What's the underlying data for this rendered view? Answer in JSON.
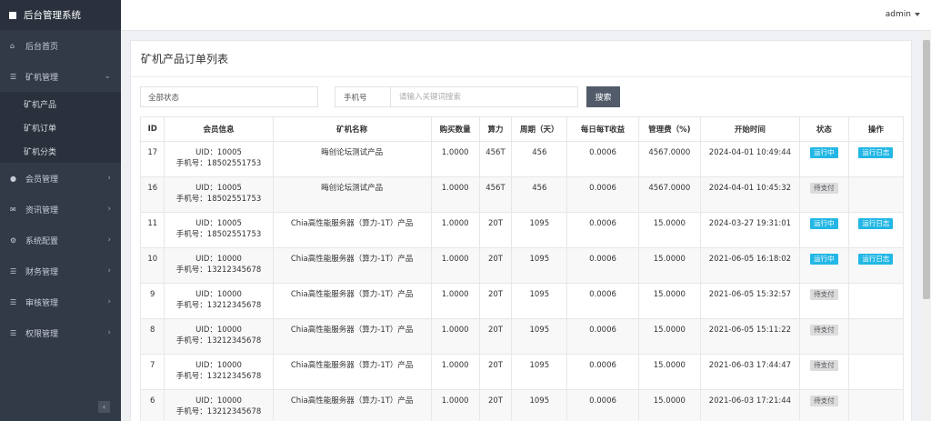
{
  "sidebar": {
    "brand": "后台管理系统",
    "home": "后台首页",
    "miner_mgmt": "矿机管理",
    "miner_sub": [
      "矿机产品",
      "矿机订单",
      "矿机分类"
    ],
    "member_mgmt": "会员管理",
    "news_mgmt": "资讯管理",
    "system_config": "系统配置",
    "finance_mgmt": "财务管理",
    "audit_mgmt": "审核管理",
    "permission_mgmt": "权限管理",
    "collapse": "‹"
  },
  "topbar": {
    "user": "admin"
  },
  "page": {
    "title": "矿机产品订单列表"
  },
  "filters": {
    "status_selected": "全部状态",
    "field_selected": "手机号",
    "keyword_placeholder": "请输入关键词搜索",
    "search_label": "搜索"
  },
  "table": {
    "headers": [
      "ID",
      "会员信息",
      "矿机名称",
      "购买数量",
      "算力",
      "周期（天）",
      "每日每T收益",
      "管理费（%)",
      "开始时间",
      "状态",
      "操作"
    ],
    "rows": [
      {
        "id": "17",
        "uid": "UID：10005",
        "phone": "手机号：18502551753",
        "name": "晦创论坛测试产品",
        "qty": "1.0000",
        "power": "456T",
        "cycle": "456",
        "daily": "0.0006",
        "fee": "4567.0000",
        "start": "2024-04-01 10:49:44",
        "status": "运行中",
        "action": "运行日志"
      },
      {
        "id": "16",
        "uid": "UID：10005",
        "phone": "手机号：18502551753",
        "name": "晦创论坛测试产品",
        "qty": "1.0000",
        "power": "456T",
        "cycle": "456",
        "daily": "0.0006",
        "fee": "4567.0000",
        "start": "2024-04-01 10:45:32",
        "status": "待支付",
        "action": ""
      },
      {
        "id": "11",
        "uid": "UID：10005",
        "phone": "手机号：18502551753",
        "name": "Chia高性能服务器（算力-1T）产品",
        "qty": "1.0000",
        "power": "20T",
        "cycle": "1095",
        "daily": "0.0006",
        "fee": "15.0000",
        "start": "2024-03-27 19:31:01",
        "status": "运行中",
        "action": "运行日志"
      },
      {
        "id": "10",
        "uid": "UID：10000",
        "phone": "手机号：13212345678",
        "name": "Chia高性能服务器（算力-1T）产品",
        "qty": "1.0000",
        "power": "20T",
        "cycle": "1095",
        "daily": "0.0006",
        "fee": "15.0000",
        "start": "2021-06-05 16:18:02",
        "status": "运行中",
        "action": "运行日志"
      },
      {
        "id": "9",
        "uid": "UID：10000",
        "phone": "手机号：13212345678",
        "name": "Chia高性能服务器（算力-1T）产品",
        "qty": "1.0000",
        "power": "20T",
        "cycle": "1095",
        "daily": "0.0006",
        "fee": "15.0000",
        "start": "2021-06-05 15:32:57",
        "status": "待支付",
        "action": ""
      },
      {
        "id": "8",
        "uid": "UID：10000",
        "phone": "手机号：13212345678",
        "name": "Chia高性能服务器（算力-1T）产品",
        "qty": "1.0000",
        "power": "20T",
        "cycle": "1095",
        "daily": "0.0006",
        "fee": "15.0000",
        "start": "2021-06-05 15:11:22",
        "status": "待支付",
        "action": ""
      },
      {
        "id": "7",
        "uid": "UID：10000",
        "phone": "手机号：13212345678",
        "name": "Chia高性能服务器（算力-1T）产品",
        "qty": "1.0000",
        "power": "20T",
        "cycle": "1095",
        "daily": "0.0006",
        "fee": "15.0000",
        "start": "2021-06-03 17:44:47",
        "status": "待支付",
        "action": ""
      },
      {
        "id": "6",
        "uid": "UID：10000",
        "phone": "手机号：13212345678",
        "name": "Chia高性能服务器（算力-1T）产品",
        "qty": "1.0000",
        "power": "20T",
        "cycle": "1095",
        "daily": "0.0006",
        "fee": "15.0000",
        "start": "2021-06-03 17:21:44",
        "status": "待支付",
        "action": ""
      }
    ]
  },
  "colors": {
    "sidebar_bg": "#323a48",
    "accent": "#23b7e5",
    "search_btn": "#515b6a"
  },
  "icons": {
    "brand": "square-icon",
    "home": "home-icon",
    "miner": "list-icon",
    "member": "user-icon",
    "news": "envelope-icon",
    "system": "cogs-icon",
    "finance": "list-icon",
    "audit": "list-icon",
    "permission": "list-icon"
  }
}
